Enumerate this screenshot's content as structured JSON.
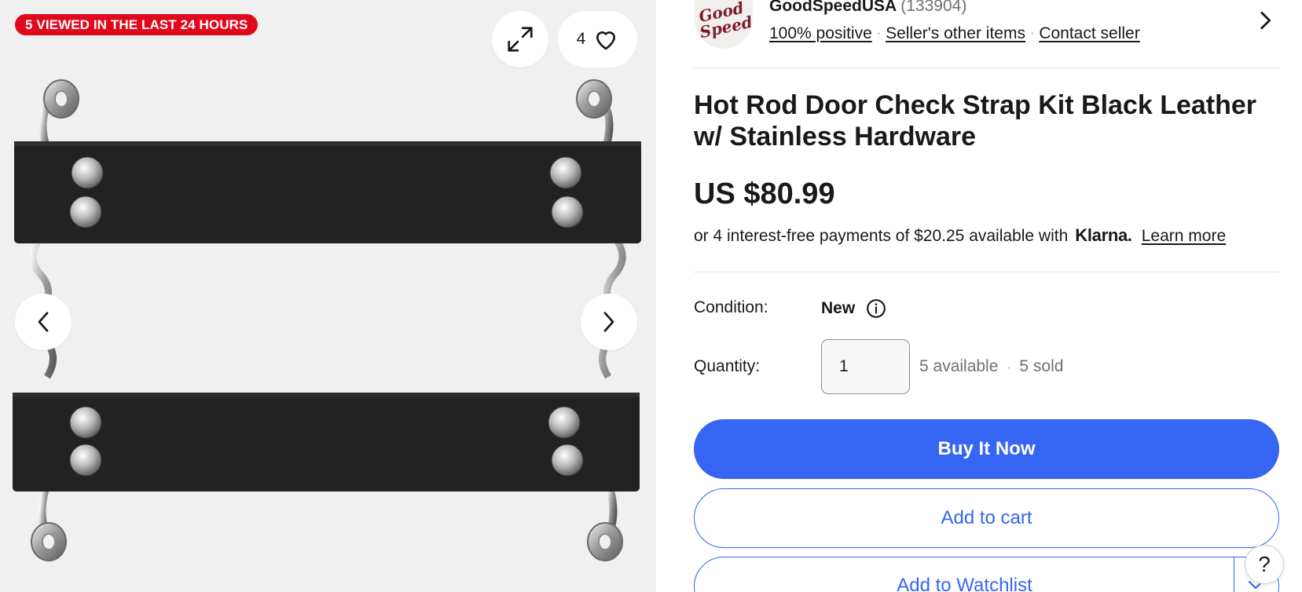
{
  "gallery": {
    "viewed_badge": "5 VIEWED IN THE LAST 24 HOURS",
    "watch_count": "4",
    "expand_icon": "expand-icon",
    "heart_icon": "heart-icon",
    "prev_icon": "chevron-left-icon",
    "next_icon": "chevron-right-icon"
  },
  "seller": {
    "name": "GoodSpeedUSA",
    "feedback_count": "(133904)",
    "links": {
      "positive": "100% positive",
      "other_items": "Seller's other items",
      "contact": "Contact seller"
    },
    "logo_text_1": "Good",
    "logo_text_2": "Speed"
  },
  "listing": {
    "title": "Hot Rod Door Check Strap Kit Black Leather w/ Stainless Hardware",
    "price": "US $80.99",
    "klarna": {
      "prefix": "or 4 interest-free payments of $20.25 available with",
      "brand": "Klarna.",
      "learn_more": "Learn more"
    },
    "condition_label": "Condition:",
    "condition_value": "New",
    "quantity_label": "Quantity:",
    "quantity_value": "1",
    "available": "5 available",
    "separator": "·",
    "sold": "5 sold"
  },
  "actions": {
    "buy_now": "Buy It Now",
    "add_to_cart": "Add to cart",
    "add_to_watchlist": "Add to Watchlist"
  },
  "help": {
    "label": "?"
  },
  "colors": {
    "accent": "#3665f3",
    "badge": "#e0091b",
    "gallery_bg": "#f0f0f0",
    "leather": "#222222"
  }
}
